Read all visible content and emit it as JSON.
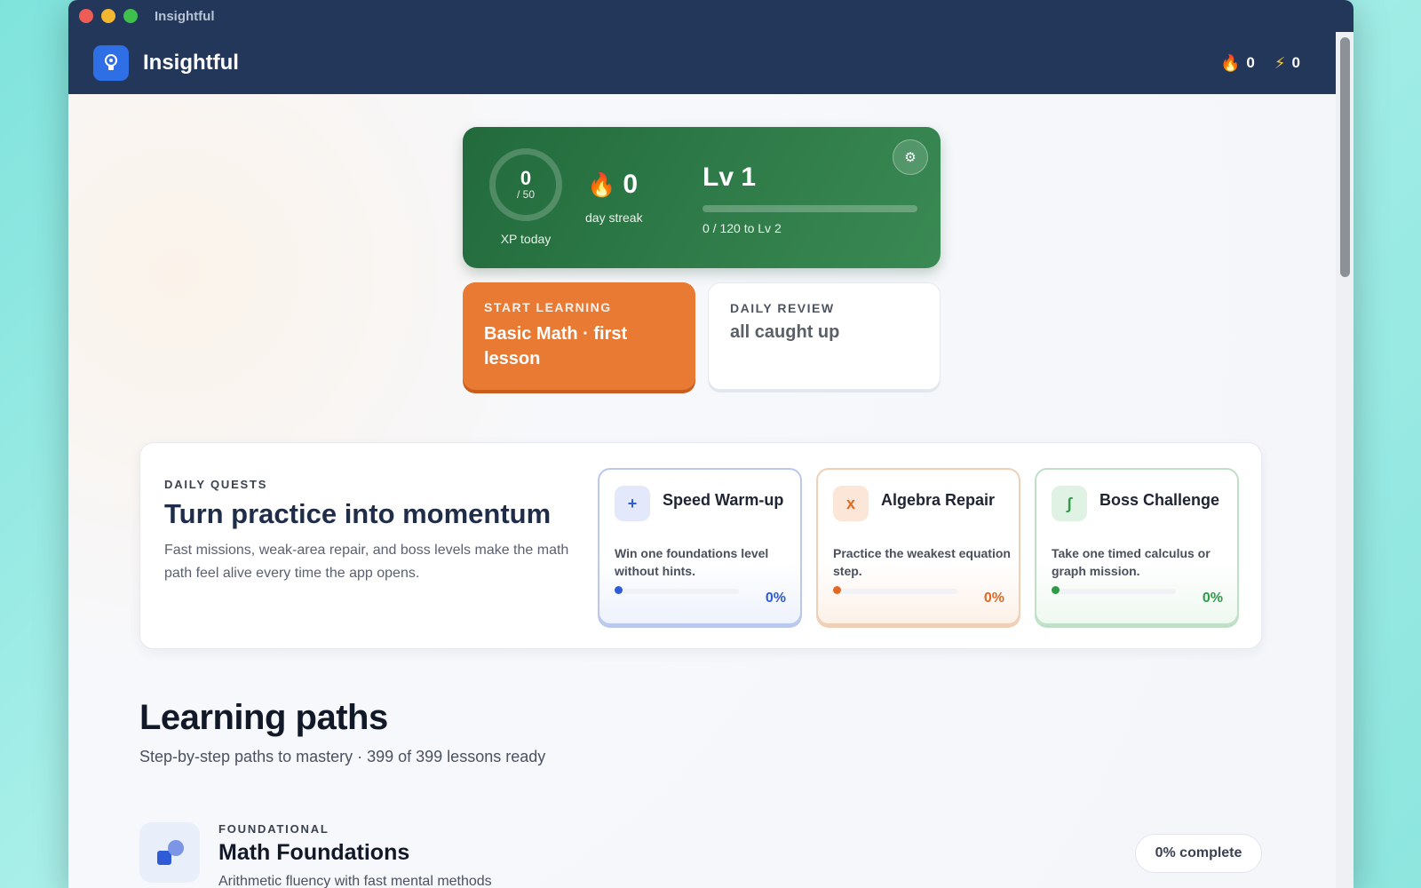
{
  "window": {
    "title": "Insightful"
  },
  "header": {
    "brand": "Insightful",
    "logo_icon": "lightbulb-head-icon",
    "streak_count": "0",
    "energy_count": "0"
  },
  "hero": {
    "xp_value": "0",
    "xp_goal": "/ 50",
    "xp_label": "XP today",
    "streak_value": "0",
    "streak_label": "day streak",
    "level_label": "Lv 1",
    "level_progress_text": "0 / 120 to Lv 2",
    "level_progress_fraction": 0,
    "settings_icon": "gear-icon"
  },
  "cards": {
    "start": {
      "kicker": "START LEARNING",
      "title": "Basic Math · first lesson"
    },
    "review": {
      "kicker": "DAILY REVIEW",
      "title": "all caught up"
    }
  },
  "quests": {
    "kicker": "DAILY QUESTS",
    "title": "Turn practice into momentum",
    "subtitle": "Fast missions, weak-area repair, and boss levels make the math path feel alive every time the app opens.",
    "items": [
      {
        "icon": "+",
        "name": "Speed Warm-up",
        "desc": "Win one foundations level without hints.",
        "progress": "0%"
      },
      {
        "icon": "x",
        "name": "Algebra Repair",
        "desc": "Practice the weakest equation step.",
        "progress": "0%"
      },
      {
        "icon": "∫",
        "name": "Boss Challenge",
        "desc": "Take one timed calculus or graph mission.",
        "progress": "0%"
      }
    ]
  },
  "learning_paths": {
    "title": "Learning paths",
    "subtitle": "Step-by-step paths to mastery · 399 of 399 lessons ready",
    "paths": [
      {
        "kicker": "FOUNDATIONAL",
        "name": "Math Foundations",
        "desc": "Arithmetic fluency with fast mental methods",
        "progress": "0% complete"
      }
    ]
  },
  "colors": {
    "navy": "#22375a",
    "green": "#2d7a48",
    "orange": "#e97a34",
    "blue": "#2f5bd6"
  }
}
